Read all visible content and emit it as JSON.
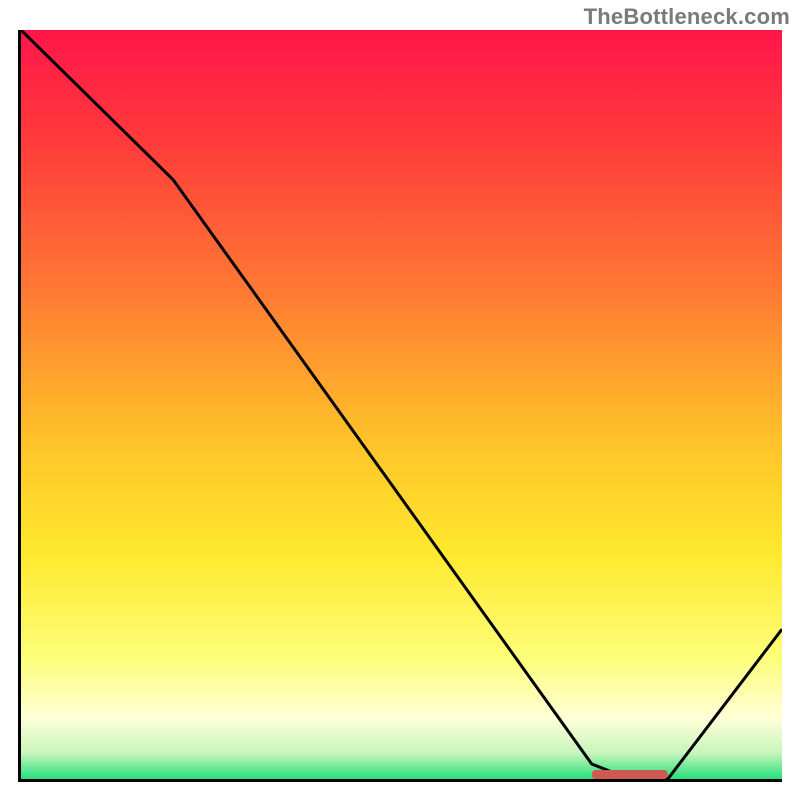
{
  "watermark": "TheBottleneck.com",
  "chart_data": {
    "type": "line",
    "title": "",
    "xlabel": "",
    "ylabel": "",
    "x_range": [
      0,
      100
    ],
    "y_range": [
      0,
      100
    ],
    "series": [
      {
        "name": "bottleneck-curve",
        "x": [
          0,
          20,
          75,
          80,
          85,
          100
        ],
        "values": [
          100,
          80,
          2,
          0,
          0,
          20
        ]
      }
    ],
    "annotations": [
      {
        "name": "optimal-band",
        "x_start": 75,
        "x_end": 85,
        "y": 0
      }
    ],
    "gradient_stops": [
      {
        "offset": 0.0,
        "color": "#FF1649"
      },
      {
        "offset": 0.15,
        "color": "#FF3B3B"
      },
      {
        "offset": 0.35,
        "color": "#FF7A33"
      },
      {
        "offset": 0.55,
        "color": "#FFC329"
      },
      {
        "offset": 0.7,
        "color": "#FFE92E"
      },
      {
        "offset": 0.84,
        "color": "#FDFE7A"
      },
      {
        "offset": 0.92,
        "color": "#FEFFD8"
      },
      {
        "offset": 0.965,
        "color": "#C8F5BC"
      },
      {
        "offset": 1.0,
        "color": "#24E07B"
      }
    ],
    "line_color": "#000000",
    "optimal_marker_color": "#CC5A52"
  }
}
